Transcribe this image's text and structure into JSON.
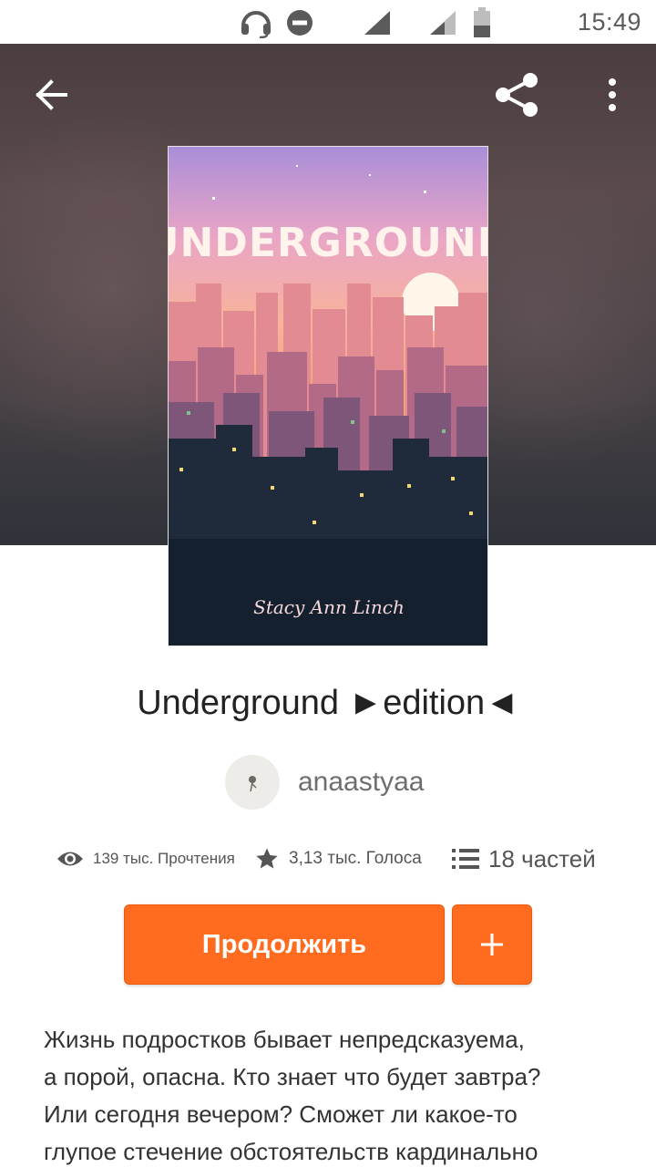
{
  "status_bar": {
    "time": "15:49"
  },
  "cover": {
    "title_art": "UNDERGROUND",
    "author_art": "Stacy Ann Linch"
  },
  "story": {
    "title": "Underground ►edition◄",
    "author": "anaastyaa"
  },
  "stats": {
    "reads": "139 тыс. Прочтения",
    "votes": "3,13 тыс. Голоса",
    "parts": "18 частей"
  },
  "actions": {
    "continue_label": "Продолжить"
  },
  "description": {
    "lines": [
      "Жизнь подростков бывает непредсказуема,",
      "а порой, опасна. Кто знает что будет завтра?",
      "Или сегодня вечером? Сможет ли какое-то",
      "глупое стечение обстоятельств кардинально"
    ]
  },
  "icons": [
    "headset-icon",
    "do-not-disturb-icon",
    "signal-icon",
    "battery-icon",
    "back-arrow-icon",
    "share-icon",
    "more-vert-icon",
    "eye-icon",
    "star-icon",
    "list-icon",
    "plus-icon"
  ],
  "colors": {
    "accent": "#ff6c1f",
    "header_bg": "#4a3d40"
  }
}
